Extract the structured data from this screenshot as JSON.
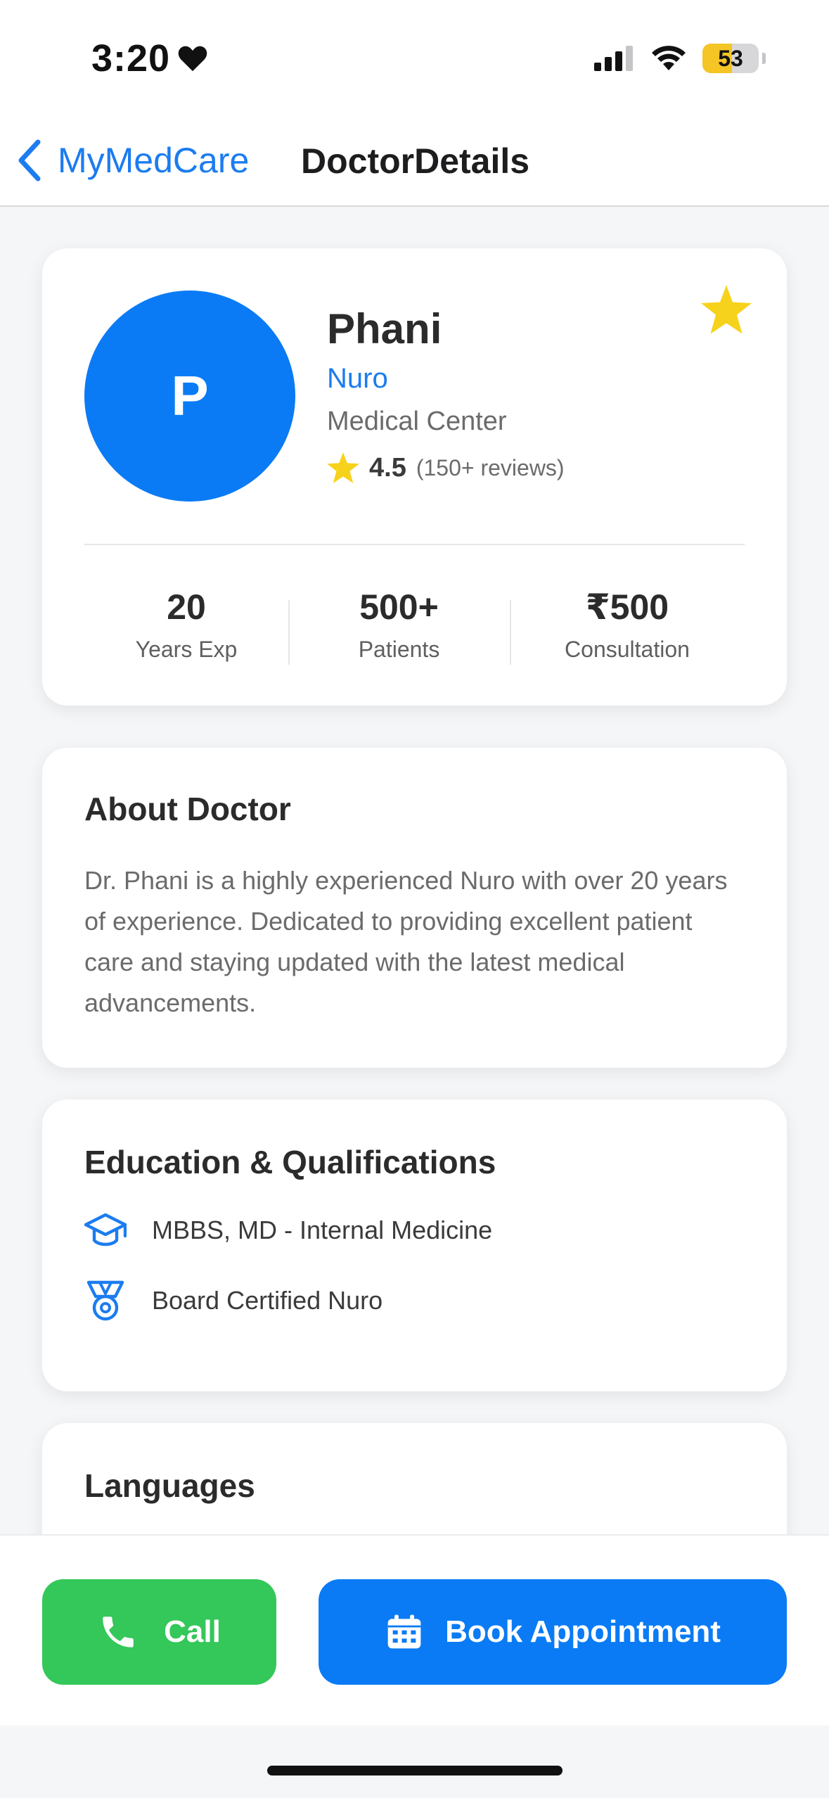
{
  "status_bar": {
    "time": "3:20",
    "battery": "53",
    "battery_level": 0.53
  },
  "nav": {
    "back_label": "MyMedCare",
    "title": "DoctorDetails"
  },
  "doctor": {
    "avatar_initial": "P",
    "name": "Phani",
    "specialty": "Nuro",
    "center": "Medical Center",
    "rating": "4.5",
    "reviews": "(150+ reviews)"
  },
  "stats": [
    {
      "value": "20",
      "label": "Years Exp"
    },
    {
      "value": "500+",
      "label": "Patients"
    },
    {
      "value": "₹500",
      "label": "Consultation"
    }
  ],
  "about": {
    "title": "About Doctor",
    "text": "Dr. Phani is a highly experienced Nuro with over 20 years of experience. Dedicated to providing excellent patient care and staying updated with the latest medical advancements."
  },
  "education": {
    "title": "Education & Qualifications",
    "items": [
      {
        "icon": "graduation-cap-icon",
        "label": "MBBS, MD - Internal Medicine"
      },
      {
        "icon": "medal-icon",
        "label": "Board Certified Nuro"
      }
    ]
  },
  "languages": {
    "title": "Languages"
  },
  "actions": {
    "call_label": "Call",
    "book_label": "Book Appointment"
  },
  "colors": {
    "accent": "#0a7bf5",
    "call_green": "#34c759",
    "star_yellow": "#f7d21c"
  }
}
